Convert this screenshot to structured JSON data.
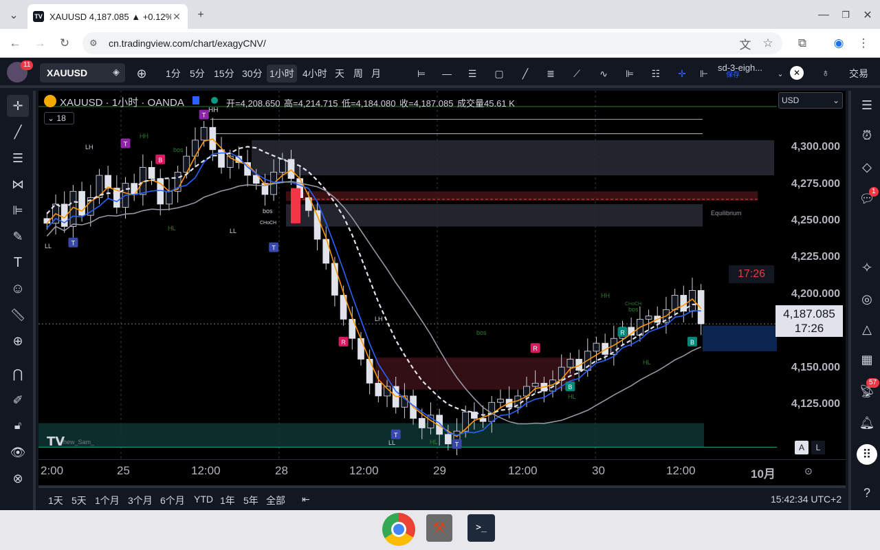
{
  "browser": {
    "tab_title": "XAUUSD 4,187.085 ▲ +0.12%",
    "favicon_text": "TV",
    "url": "cn.tradingview.com/chart/exagyCNV/"
  },
  "topbar": {
    "avatar_badge": "11",
    "symbol": "XAUUSD",
    "timeframes": [
      "1分",
      "5分",
      "15分",
      "30分",
      "1小时",
      "4小时",
      "天",
      "周",
      "月"
    ],
    "active_timeframe": "1小时",
    "layout_name": "sd-3-eigh...",
    "layout_saved": "保存",
    "trade_label": "交易"
  },
  "legend": {
    "title": "XAUUSD · 1小时 · OANDA",
    "open_label": "开",
    "open": "=4,208.650",
    "high_label": "高",
    "high": "=4,214.715",
    "low_label": "低",
    "low": "=4,184.080",
    "close_label": "收",
    "close": "=4,187.085",
    "volume_label": "成交量",
    "volume": "45.61 K",
    "indicator_count": "18"
  },
  "price_axis": {
    "currency": "USD",
    "ticks": [
      "4,300.000",
      "4,275.000",
      "4,250.000",
      "4,225.000",
      "4,200.000",
      "4,150.000",
      "4,125.000"
    ],
    "current_price": "4,187.085",
    "countdown": "17:26",
    "alert_time": "17:26"
  },
  "time_axis": {
    "ticks": [
      "2:00",
      "25",
      "12:00",
      "28",
      "12:00",
      "29",
      "12:00",
      "30",
      "12:00",
      "10月"
    ]
  },
  "annotations": {
    "hh1": "HH",
    "hh2": "HH",
    "hh3": "HH",
    "lh1": "LH",
    "lh2": "LH",
    "ll1": "LL",
    "ll2": "LL",
    "ll3": "LL",
    "hl1": "HL",
    "hl2": "HL",
    "hl3": "HL",
    "hl4": "HL",
    "bos1": "bos",
    "bos2": "bos",
    "bos3": "bos",
    "bos4": "bos",
    "choch1": "CHoCH",
    "choch2": "CHoCH",
    "equilibrium": "Equilibrium",
    "watermark": "hew_Sam_"
  },
  "bottombar": {
    "ranges": [
      "1天",
      "5天",
      "1个月",
      "3个月",
      "6个月",
      "YTD",
      "1年",
      "5年",
      "全部"
    ],
    "clock": "15:42:34 UTC+2",
    "scale_auto": "A",
    "scale_log": "L"
  },
  "rightbar": {
    "chat_badge": "1",
    "feed_badge": "57"
  },
  "chart_data": {
    "type": "candlestick",
    "symbol": "XAUUSD",
    "interval": "1小时",
    "ylim": [
      4105,
      4320
    ],
    "close_prices": [
      4250,
      4262,
      4248,
      4270,
      4255,
      4266,
      4280,
      4272,
      4260,
      4275,
      4268,
      4285,
      4278,
      4262,
      4270,
      4282,
      4292,
      4302,
      4310,
      4296,
      4285,
      4292,
      4288,
      4280,
      4275,
      4268,
      4282,
      4290,
      4278,
      4266,
      4258,
      4240,
      4225,
      4205,
      4190,
      4178,
      4165,
      4150,
      4142,
      4148,
      4135,
      4142,
      4128,
      4122,
      4130,
      4118,
      4112,
      4120,
      4132,
      4128,
      4126,
      4138,
      4140,
      4135,
      4142,
      4148,
      4150,
      4145,
      4152,
      4160,
      4165,
      4158,
      4170,
      4175,
      4168,
      4178,
      4185,
      4180,
      4190,
      4192,
      4188,
      4196,
      4205,
      4195,
      4208,
      4187.085
    ],
    "moving_averages": [
      {
        "color": "#ff9800",
        "style": "solid"
      },
      {
        "color": "#2962ff",
        "style": "solid"
      },
      {
        "color": "#e0e3eb",
        "style": "dashed"
      },
      {
        "color": "#9598a1",
        "style": "solid"
      }
    ]
  }
}
